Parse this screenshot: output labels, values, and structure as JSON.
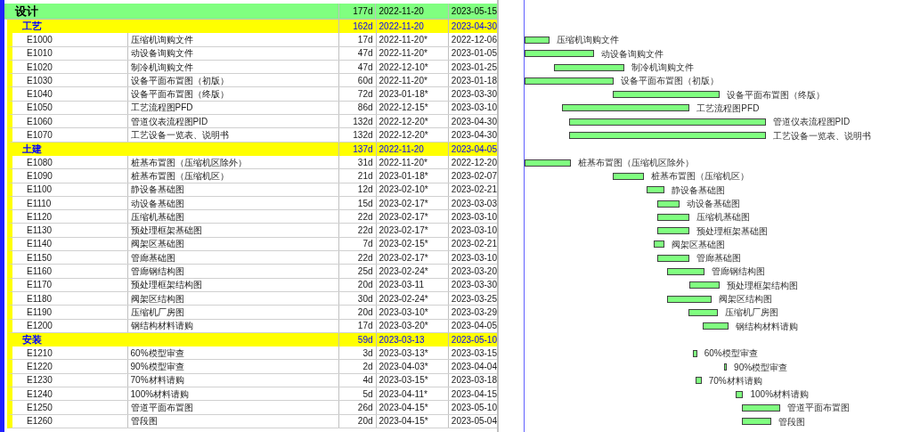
{
  "plan": {
    "name": "设计",
    "duration": "177d",
    "start": "2022-11-20",
    "finish": "2023-05-15",
    "children": [
      {
        "name": "工艺",
        "duration": "162d",
        "start": "2022-11-20",
        "finish": "2023-04-30",
        "children": [
          {
            "id": "E1000",
            "name": "压缩机询购文件",
            "duration": "17d",
            "start": "2022-11-20*",
            "finish": "2022-12-06",
            "bar_label": "压缩机询购文件"
          },
          {
            "id": "E1010",
            "name": "动设备询购文件",
            "duration": "47d",
            "start": "2022-11-20*",
            "finish": "2023-01-05",
            "bar_label": "动设备询购文件"
          },
          {
            "id": "E1020",
            "name": "制冷机询购文件",
            "duration": "47d",
            "start": "2022-12-10*",
            "finish": "2023-01-25",
            "bar_label": "制冷机询购文件"
          },
          {
            "id": "E1030",
            "name": "设备平面布置图（初版）",
            "duration": "60d",
            "start": "2022-11-20*",
            "finish": "2023-01-18",
            "bar_label": "设备平面布置图（初版）"
          },
          {
            "id": "E1040",
            "name": "设备平面布置图（终版）",
            "duration": "72d",
            "start": "2023-01-18*",
            "finish": "2023-03-30",
            "bar_label": "设备平面布置图（终版）"
          },
          {
            "id": "E1050",
            "name": "工艺流程图PFD",
            "duration": "86d",
            "start": "2022-12-15*",
            "finish": "2023-03-10",
            "bar_label": "工艺流程图PFD"
          },
          {
            "id": "E1060",
            "name": "管道仪表流程图PID",
            "duration": "132d",
            "start": "2022-12-20*",
            "finish": "2023-04-30",
            "bar_label": "管道仪表流程图PID"
          },
          {
            "id": "E1070",
            "name": "工艺设备一览表、说明书",
            "duration": "132d",
            "start": "2022-12-20*",
            "finish": "2023-04-30",
            "bar_label": "工艺设备一览表、说明书"
          }
        ]
      },
      {
        "name": "土建",
        "duration": "137d",
        "start": "2022-11-20",
        "finish": "2023-04-05",
        "children": [
          {
            "id": "E1080",
            "name": "桩基布置图（压缩机区除外）",
            "duration": "31d",
            "start": "2022-11-20*",
            "finish": "2022-12-20",
            "bar_label": "桩基布置图（压缩机区除外）"
          },
          {
            "id": "E1090",
            "name": "桩基布置图（压缩机区）",
            "duration": "21d",
            "start": "2023-01-18*",
            "finish": "2023-02-07",
            "bar_label": "桩基布置图（压缩机区）"
          },
          {
            "id": "E1100",
            "name": "静设备基础图",
            "duration": "12d",
            "start": "2023-02-10*",
            "finish": "2023-02-21",
            "bar_label": "静设备基础图"
          },
          {
            "id": "E1110",
            "name": "动设备基础图",
            "duration": "15d",
            "start": "2023-02-17*",
            "finish": "2023-03-03",
            "bar_label": "动设备基础图"
          },
          {
            "id": "E1120",
            "name": "压缩机基础图",
            "duration": "22d",
            "start": "2023-02-17*",
            "finish": "2023-03-10",
            "bar_label": "压缩机基础图"
          },
          {
            "id": "E1130",
            "name": "预处理框架基础图",
            "duration": "22d",
            "start": "2023-02-17*",
            "finish": "2023-03-10",
            "bar_label": "预处理框架基础图"
          },
          {
            "id": "E1140",
            "name": "阀架区基础图",
            "duration": "7d",
            "start": "2023-02-15*",
            "finish": "2023-02-21",
            "bar_label": "阀架区基础图"
          },
          {
            "id": "E1150",
            "name": "管廊基础图",
            "duration": "22d",
            "start": "2023-02-17*",
            "finish": "2023-03-10",
            "bar_label": "管廊基础图"
          },
          {
            "id": "E1160",
            "name": "管廊钢结构图",
            "duration": "25d",
            "start": "2023-02-24*",
            "finish": "2023-03-20",
            "bar_label": "管廊钢结构图"
          },
          {
            "id": "E1170",
            "name": "预处理框架结构图",
            "duration": "20d",
            "start": "2023-03-11",
            "finish": "2023-03-30",
            "bar_label": "预处理框架结构图"
          },
          {
            "id": "E1180",
            "name": "阀架区结构图",
            "duration": "30d",
            "start": "2023-02-24*",
            "finish": "2023-03-25",
            "bar_label": "阀架区结构图"
          },
          {
            "id": "E1190",
            "name": "压缩机厂房图",
            "duration": "20d",
            "start": "2023-03-10*",
            "finish": "2023-03-29",
            "bar_label": "压缩机厂房图"
          },
          {
            "id": "E1200",
            "name": "钢结构材料请购",
            "duration": "17d",
            "start": "2023-03-20*",
            "finish": "2023-04-05",
            "bar_label": "钢结构材料请购"
          }
        ]
      },
      {
        "name": "安装",
        "duration": "59d",
        "start": "2023-03-13",
        "finish": "2023-05-10",
        "children": [
          {
            "id": "E1210",
            "name": "60%模型审查",
            "duration": "3d",
            "start": "2023-03-13*",
            "finish": "2023-03-15",
            "bar_label": "60%模型审查"
          },
          {
            "id": "E1220",
            "name": "90%模型审查",
            "duration": "2d",
            "start": "2023-04-03*",
            "finish": "2023-04-04",
            "bar_label": "90%模型审查"
          },
          {
            "id": "E1230",
            "name": "70%材料请购",
            "duration": "4d",
            "start": "2023-03-15*",
            "finish": "2023-03-18",
            "bar_label": "70%材料请购"
          },
          {
            "id": "E1240",
            "name": "100%材料请购",
            "duration": "5d",
            "start": "2023-04-11*",
            "finish": "2023-04-15",
            "bar_label": "100%材料请购"
          },
          {
            "id": "E1250",
            "name": "管道平面布置图",
            "duration": "26d",
            "start": "2023-04-15*",
            "finish": "2023-05-10",
            "bar_label": "管道平面布置图"
          },
          {
            "id": "E1260",
            "name": "管段图",
            "duration": "20d",
            "start": "2023-04-15*",
            "finish": "2023-05-04",
            "bar_label": "管段图"
          }
        ]
      }
    ]
  }
}
